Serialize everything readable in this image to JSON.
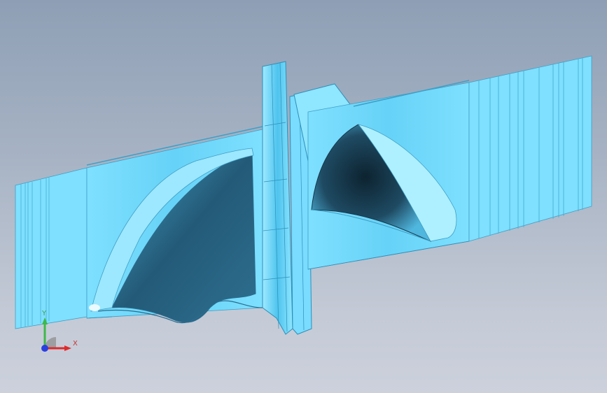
{
  "viewport": {
    "background_top": "#8e9fb5",
    "background_bottom": "#ccd1dc",
    "model_color": "#5fd0f5",
    "shadow_color": "#1c4e66"
  },
  "triad": {
    "x_label": "X",
    "y_label": "Y",
    "x_color": "#e02a2a",
    "y_color": "#3fb84a",
    "z_color": "#2a3fe0"
  }
}
